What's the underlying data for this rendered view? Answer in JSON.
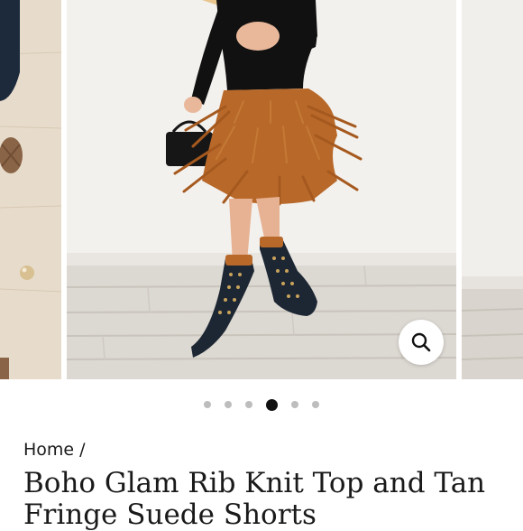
{
  "gallery": {
    "zoom_icon": "search-icon",
    "pagination": {
      "total": 6,
      "active_index": 3
    }
  },
  "breadcrumb": {
    "home_label": "Home",
    "separator": "/"
  },
  "product": {
    "title": "Boho Glam Rib Knit Top and Tan Fringe Suede Shorts"
  },
  "colors": {
    "fringe": "#b8692a",
    "top": "#111111",
    "boots": "#1d2733",
    "accent": "#111111"
  }
}
